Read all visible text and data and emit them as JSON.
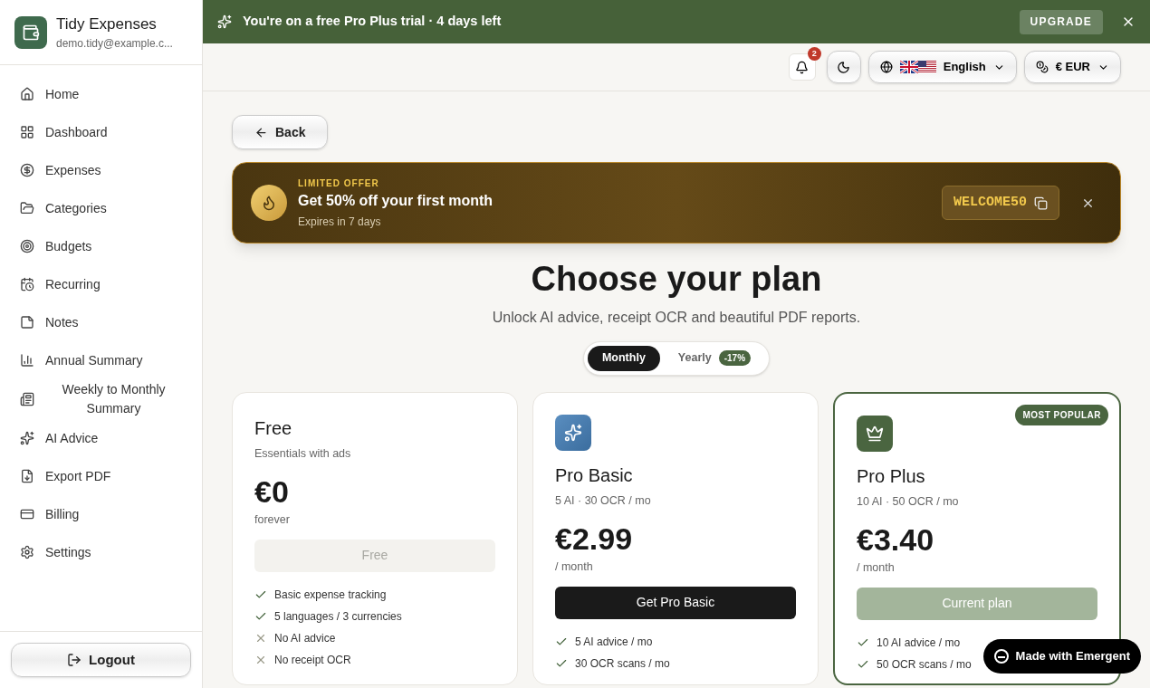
{
  "app": {
    "name": "Tidy Expenses",
    "email": "demo.tidy@example.c..."
  },
  "sidebar": {
    "items": [
      {
        "label": "Home"
      },
      {
        "label": "Dashboard"
      },
      {
        "label": "Expenses"
      },
      {
        "label": "Categories"
      },
      {
        "label": "Budgets"
      },
      {
        "label": "Recurring"
      },
      {
        "label": "Notes"
      },
      {
        "label": "Annual Summary"
      },
      {
        "label": "Weekly to Monthly Summary"
      },
      {
        "label": "AI Advice"
      },
      {
        "label": "Export PDF"
      },
      {
        "label": "Billing"
      },
      {
        "label": "Settings"
      }
    ],
    "logout": "Logout"
  },
  "trial_bar": {
    "text": "You're on a free Pro Plus trial · 4 days left",
    "button": "UPGRADE"
  },
  "header": {
    "notifications": "2",
    "language": "English",
    "currency": "€ EUR"
  },
  "back": "Back",
  "offer": {
    "eyebrow": "LIMITED OFFER",
    "title": "Get 50% off your first month",
    "expires": "Expires in 7 days",
    "code": "WELCOME50"
  },
  "title": "Choose your plan",
  "subtitle": "Unlock AI advice, receipt OCR and beautiful PDF reports.",
  "billing_toggle": [
    {
      "label": "Monthly",
      "selected": true
    },
    {
      "label": "Yearly",
      "badge": "-17%",
      "selected": false
    }
  ],
  "plans": [
    {
      "name": "Free",
      "subtitle": "Essentials with ads",
      "price": "€0",
      "period": "forever",
      "button": {
        "label": "Free",
        "kind": "disabled"
      },
      "highlighted": false,
      "features": [
        {
          "text": "Basic expense tracking",
          "kind": "check"
        },
        {
          "text": "5 languages / 3 currencies",
          "kind": "check"
        },
        {
          "text": "No AI advice",
          "kind": "cross"
        },
        {
          "text": "No receipt OCR",
          "kind": "cross"
        }
      ]
    },
    {
      "name": "Pro Basic",
      "subtitle": "5 AI · 30 OCR / mo",
      "price": "€2.99",
      "period": "/ month",
      "button": {
        "label": "Get Pro Basic",
        "kind": "primary"
      },
      "highlighted": false,
      "features": [
        {
          "text": "5 AI advice / mo",
          "kind": "check"
        },
        {
          "text": "30 OCR scans / mo",
          "kind": "check"
        }
      ]
    },
    {
      "name": "Pro Plus",
      "subtitle": "10 AI · 50 OCR / mo",
      "price": "€3.40",
      "period": "/ month",
      "badge": "MOST POPULAR",
      "button": {
        "label": "Current plan",
        "kind": "current"
      },
      "highlighted": true,
      "features": [
        {
          "text": "10 AI advice / mo",
          "kind": "check"
        },
        {
          "text": "50 OCR scans / mo",
          "kind": "check"
        }
      ]
    }
  ],
  "made_with": "Made with Emergent"
}
